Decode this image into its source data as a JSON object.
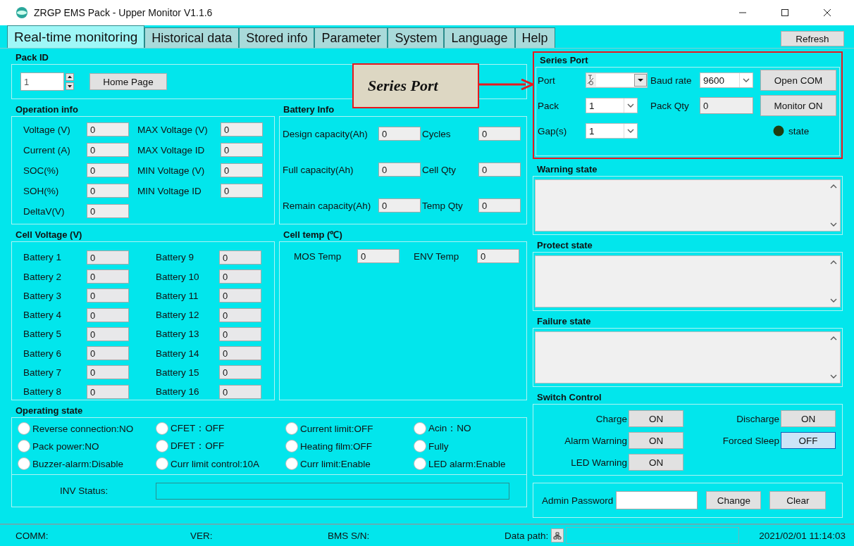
{
  "window": {
    "title": "ZRGP EMS Pack - Upper Monitor V1.1.6"
  },
  "tabs": [
    {
      "label": "Real-time monitoring",
      "selected": true
    },
    {
      "label": "Historical data",
      "selected": false
    },
    {
      "label": "Stored info",
      "selected": false
    },
    {
      "label": "Parameter",
      "selected": false
    },
    {
      "label": "System",
      "selected": false
    },
    {
      "label": "Language",
      "selected": false
    },
    {
      "label": "Help",
      "selected": false
    }
  ],
  "refresh_button": "Refresh",
  "pack_id": {
    "title": "Pack ID",
    "value": "1",
    "home_button": "Home Page"
  },
  "annotation": {
    "label": "Series Port"
  },
  "operation_info": {
    "title": "Operation info",
    "fields": [
      {
        "label": "Voltage (V)",
        "value": "0"
      },
      {
        "label": "MAX Voltage (V)",
        "value": "0"
      },
      {
        "label": "Current (A)",
        "value": "0"
      },
      {
        "label": "MAX Voltage ID",
        "value": "0"
      },
      {
        "label": "SOC(%)",
        "value": "0"
      },
      {
        "label": "MIN Voltage (V)",
        "value": "0"
      },
      {
        "label": "SOH(%)",
        "value": "0"
      },
      {
        "label": "MIN Voltage ID",
        "value": "0"
      },
      {
        "label": "DeltaV(V)",
        "value": "0"
      }
    ]
  },
  "battery_info": {
    "title": "Battery Info",
    "fields": [
      {
        "label": "Design capacity(Ah)",
        "value": "0"
      },
      {
        "label": "Cycles",
        "value": "0"
      },
      {
        "label": "Full capacity(Ah)",
        "value": "0"
      },
      {
        "label": "Cell Qty",
        "value": "0"
      },
      {
        "label": "Remain capacity(Ah)",
        "value": "0"
      },
      {
        "label": "Temp Qty",
        "value": "0"
      }
    ]
  },
  "cell_voltage": {
    "title": "Cell Voltage (V)",
    "cells": [
      {
        "label": "Battery 1",
        "value": "0"
      },
      {
        "label": "Battery 2",
        "value": "0"
      },
      {
        "label": "Battery 3",
        "value": "0"
      },
      {
        "label": "Battery 4",
        "value": "0"
      },
      {
        "label": "Battery 5",
        "value": "0"
      },
      {
        "label": "Battery 6",
        "value": "0"
      },
      {
        "label": "Battery 7",
        "value": "0"
      },
      {
        "label": "Battery 8",
        "value": "0"
      },
      {
        "label": "Battery 9",
        "value": "0"
      },
      {
        "label": "Battery 10",
        "value": "0"
      },
      {
        "label": "Battery 11",
        "value": "0"
      },
      {
        "label": "Battery 12",
        "value": "0"
      },
      {
        "label": "Battery 13",
        "value": "0"
      },
      {
        "label": "Battery 14",
        "value": "0"
      },
      {
        "label": "Battery 15",
        "value": "0"
      },
      {
        "label": "Battery 16",
        "value": "0"
      }
    ]
  },
  "cell_temp": {
    "title": "Cell temp (℃)",
    "fields": [
      {
        "label": "MOS Temp",
        "value": "0"
      },
      {
        "label": "ENV Temp",
        "value": "0"
      }
    ]
  },
  "operating_state": {
    "title": "Operating state",
    "indicators": [
      {
        "label": "Reverse connection:NO",
        "on": false
      },
      {
        "label": "CFET：OFF",
        "on": false
      },
      {
        "label": "Current limit:OFF",
        "on": false
      },
      {
        "label": "Acin：NO",
        "on": false
      },
      {
        "label": "Pack power:NO",
        "on": false
      },
      {
        "label": "DFET：OFF",
        "on": false
      },
      {
        "label": "Heating film:OFF",
        "on": false
      },
      {
        "label": "Fully",
        "on": false
      },
      {
        "label": "Buzzer-alarm:Disable",
        "on": false
      },
      {
        "label": "Curr limit control:10A",
        "on": false
      },
      {
        "label": "Curr limit:Enable",
        "on": false
      },
      {
        "label": "LED alarm:Enable",
        "on": false
      }
    ],
    "inv_label": "INV Status:"
  },
  "series_port": {
    "title": "Series Port",
    "port_label": "Port",
    "baud_label": "Baud rate",
    "baud_value": "9600",
    "pack_label": "Pack",
    "pack_value": "1",
    "pack_qty_label": "Pack Qty",
    "pack_qty_value": "0",
    "gap_label": "Gap(s)",
    "gap_value": "1",
    "open_button": "Open COM",
    "monitor_button": "Monitor ON",
    "state_label": "state",
    "state_on": false
  },
  "state_boxes": [
    {
      "title": "Warning state"
    },
    {
      "title": "Protect state"
    },
    {
      "title": "Failure state"
    }
  ],
  "switch_control": {
    "title": "Switch Control",
    "switches": [
      {
        "label": "Charge",
        "value": "ON",
        "focused": false
      },
      {
        "label": "Discharge",
        "value": "ON",
        "focused": false
      },
      {
        "label": "Alarm Warning",
        "value": "ON",
        "focused": false
      },
      {
        "label": "Forced Sleep",
        "value": "OFF",
        "focused": true
      },
      {
        "label": "LED Warning",
        "value": "ON",
        "focused": false
      }
    ]
  },
  "admin": {
    "label": "Admin Password",
    "change_button": "Change",
    "clear_button": "Clear"
  },
  "status_bar": {
    "comm": "COMM:",
    "ver": "VER:",
    "sn": "BMS S/N:",
    "data_path": "Data path:",
    "time": "2021/02/01 11:14:03"
  }
}
